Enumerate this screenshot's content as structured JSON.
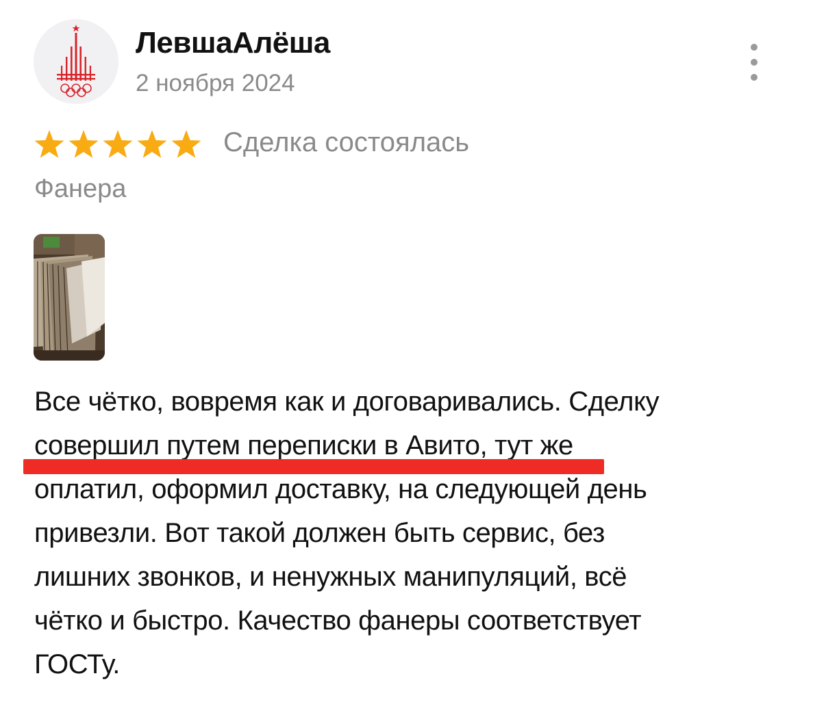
{
  "review": {
    "author": {
      "name": "ЛевшаАлёша",
      "avatar_icon": "moscow-1980-olympics-logo-icon"
    },
    "date": "2 ноября 2024",
    "more_icon": "kebab-menu-icon",
    "rating": {
      "value": 5,
      "max": 5,
      "star_color": "#f9ab14"
    },
    "deal_status": "Сделка состоялась",
    "item": "Фанера",
    "photo_icon": "plywood-sheets-photo",
    "text_lines": [
      "Все чётко, вовремя как и договаривались. Сделку",
      "совершил путем переписки в Авито, тут же",
      "оплатил, оформил доставку, на следующей день",
      "привезли. Вот такой должен быть сервис, без",
      "лишних звонков, и ненужных манипуляций, всё",
      "чётко и быстро. Качество фанеры соответствует",
      "ГОСТу."
    ],
    "highlight_color": "#ef2b26"
  }
}
